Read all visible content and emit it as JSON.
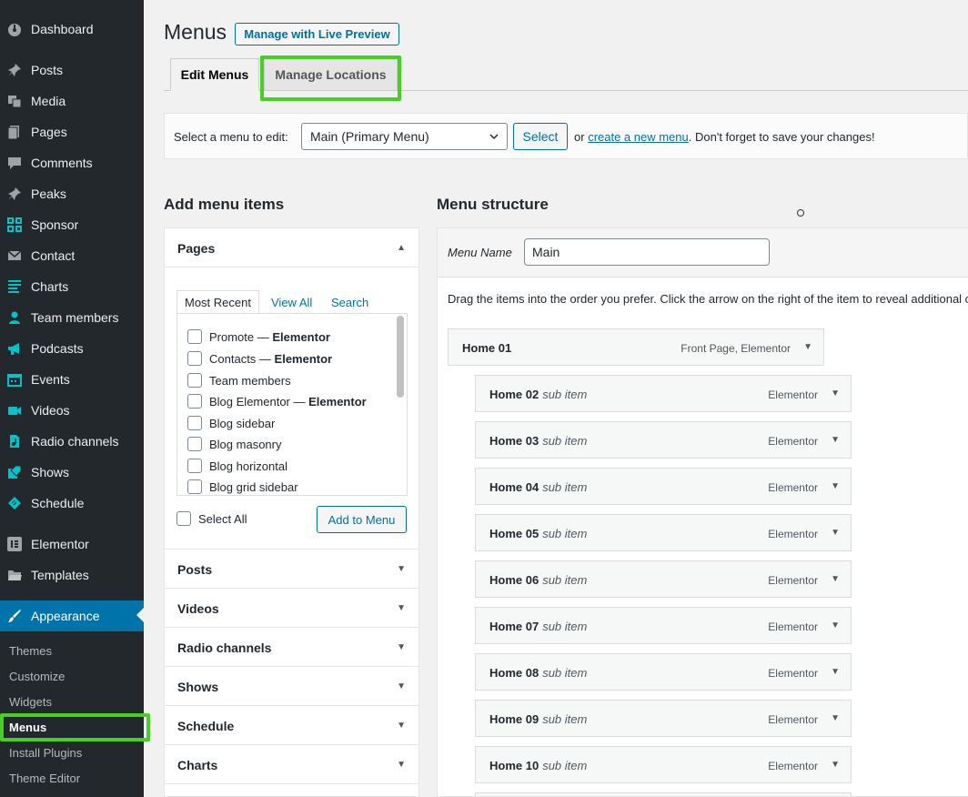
{
  "sidebar": {
    "items": [
      {
        "label": "Dashboard",
        "icon": "dashboard-icon"
      },
      {
        "label": "Posts",
        "icon": "pin-icon"
      },
      {
        "label": "Media",
        "icon": "media-icon"
      },
      {
        "label": "Pages",
        "icon": "pages-icon"
      },
      {
        "label": "Comments",
        "icon": "comment-icon"
      },
      {
        "label": "Peaks",
        "icon": "pin-icon"
      },
      {
        "label": "Sponsor",
        "icon": "grid-icon"
      },
      {
        "label": "Contact",
        "icon": "mail-icon"
      },
      {
        "label": "Charts",
        "icon": "list-icon"
      },
      {
        "label": "Team members",
        "icon": "users-icon"
      },
      {
        "label": "Podcasts",
        "icon": "megaphone-icon"
      },
      {
        "label": "Events",
        "icon": "calendar-icon"
      },
      {
        "label": "Videos",
        "icon": "video-icon"
      },
      {
        "label": "Radio channels",
        "icon": "audio-file-icon"
      },
      {
        "label": "Shows",
        "icon": "tag-icon"
      },
      {
        "label": "Schedule",
        "icon": "ticket-icon"
      },
      {
        "label": "Elementor",
        "icon": "elementor-icon"
      },
      {
        "label": "Templates",
        "icon": "folder-icon"
      },
      {
        "label": "Appearance",
        "icon": "brush-icon"
      }
    ],
    "submenu": [
      "Themes",
      "Customize",
      "Widgets",
      "Menus",
      "Install Plugins",
      "Theme Editor"
    ]
  },
  "header": {
    "title": "Menus",
    "live_preview": "Manage with Live Preview",
    "tabs": [
      "Edit Menus",
      "Manage Locations"
    ]
  },
  "manage": {
    "label": "Select a menu to edit:",
    "selected": "Main (Primary Menu)",
    "select_button": "Select",
    "text_or": "or",
    "create_link": "create a new menu",
    "text_tail": ". Don't forget to save your changes!"
  },
  "add_items": {
    "heading": "Add menu items",
    "pages_title": "Pages",
    "page_tabs": [
      "Most Recent",
      "View All",
      "Search"
    ],
    "pages": [
      {
        "name": "Promote",
        "suffix": "Elementor"
      },
      {
        "name": "Contacts",
        "suffix": "Elementor"
      },
      {
        "name": "Team members",
        "suffix": ""
      },
      {
        "name": "Blog Elementor",
        "suffix": "Elementor"
      },
      {
        "name": "Blog sidebar",
        "suffix": ""
      },
      {
        "name": "Blog masonry",
        "suffix": ""
      },
      {
        "name": "Blog horizontal",
        "suffix": ""
      },
      {
        "name": "Blog grid sidebar",
        "suffix": ""
      }
    ],
    "separator": " — ",
    "select_all": "Select All",
    "add_button": "Add to Menu",
    "sections": [
      "Posts",
      "Videos",
      "Radio channels",
      "Shows",
      "Schedule",
      "Charts"
    ]
  },
  "structure": {
    "heading": "Menu structure",
    "name_label": "Menu Name",
    "name_value": "Main",
    "hint": "Drag the items into the order you prefer. Click the arrow on the right of the item to reveal additional configuration options.",
    "items": [
      {
        "title": "Home 01",
        "sub": "",
        "type": "Front Page, Elementor"
      },
      {
        "title": "Home 02",
        "sub": "sub item",
        "type": "Elementor"
      },
      {
        "title": "Home 03",
        "sub": "sub item",
        "type": "Elementor"
      },
      {
        "title": "Home 04",
        "sub": "sub item",
        "type": "Elementor"
      },
      {
        "title": "Home 05",
        "sub": "sub item",
        "type": "Elementor"
      },
      {
        "title": "Home 06",
        "sub": "sub item",
        "type": "Elementor"
      },
      {
        "title": "Home 07",
        "sub": "sub item",
        "type": "Elementor"
      },
      {
        "title": "Home 08",
        "sub": "sub item",
        "type": "Elementor"
      },
      {
        "title": "Home 09",
        "sub": "sub item",
        "type": "Elementor"
      },
      {
        "title": "Home 10",
        "sub": "sub item",
        "type": "Elementor"
      }
    ]
  },
  "colors": {
    "sidebar_bg": "#23282d",
    "accent": "#0073aa",
    "highlight": "#44d11f",
    "icon_accent": "#00c4cc"
  }
}
